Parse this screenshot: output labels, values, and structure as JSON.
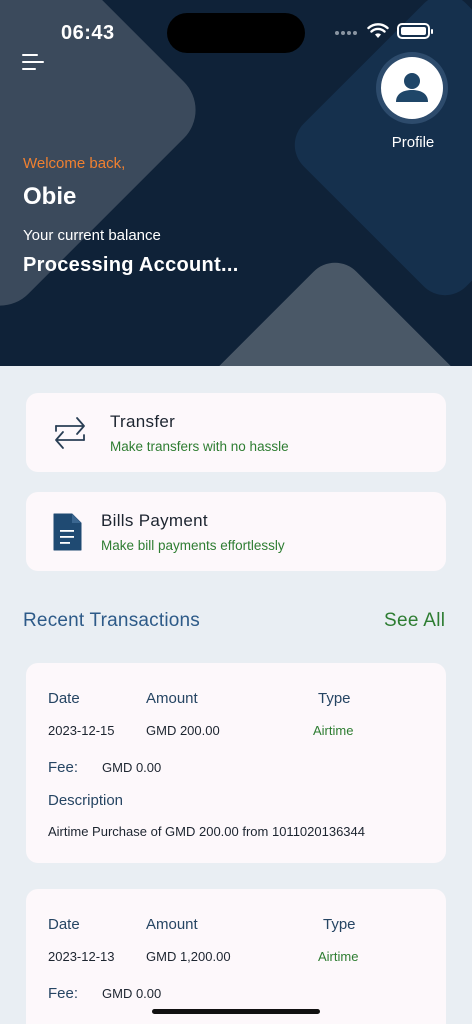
{
  "status_bar": {
    "time": "06:43"
  },
  "header": {
    "profile_label": "Profile",
    "welcome": "Welcome back,",
    "username": "Obie",
    "balance_label": "Your current balance",
    "balance_value": "Processing Account..."
  },
  "actions": [
    {
      "title": "Transfer",
      "subtitle": "Make transfers with no hassle",
      "icon": "transfer-arrows-icon"
    },
    {
      "title": "Bills Payment",
      "subtitle": "Make bill payments effortlessly",
      "icon": "document-icon"
    }
  ],
  "recent": {
    "title": "Recent Transactions",
    "see_all": "See All",
    "labels": {
      "date": "Date",
      "amount": "Amount",
      "type": "Type",
      "fee": "Fee:",
      "description": "Description"
    },
    "transactions": [
      {
        "date": "2023-12-15",
        "amount": "GMD 200.00",
        "type": "Airtime",
        "fee": "GMD 0.00",
        "description": "Airtime Purchase of GMD 200.00 from 1011020136344"
      },
      {
        "date": "2023-12-13",
        "amount": "GMD 1,200.00",
        "type": "Airtime",
        "fee": "GMD 0.00"
      }
    ]
  },
  "colors": {
    "header_bg": "#0f2238",
    "accent_orange": "#f08030",
    "accent_green": "#2e7d32",
    "accent_blue": "#2d5a88"
  }
}
